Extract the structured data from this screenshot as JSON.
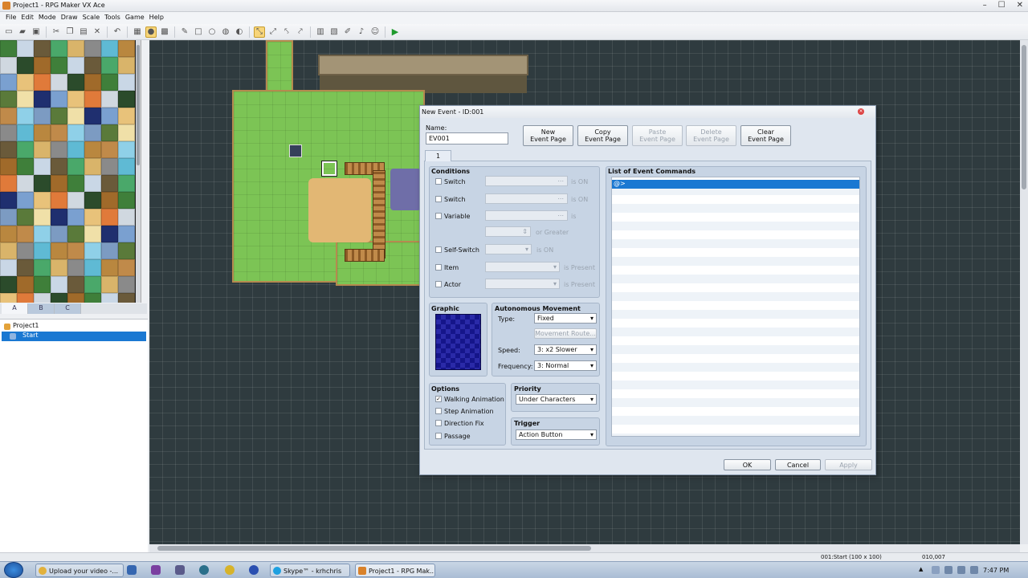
{
  "window": {
    "title": "Project1 - RPG Maker VX Ace",
    "minimize": "–",
    "maximize": "☐",
    "close": "✕"
  },
  "menu": [
    "File",
    "Edit",
    "Mode",
    "Draw",
    "Scale",
    "Tools",
    "Game",
    "Help"
  ],
  "tileset_tabs": [
    "A",
    "B",
    "C"
  ],
  "map_tree": {
    "project": "Project1",
    "map": "Start"
  },
  "dialog": {
    "title": "New Event - ID:001",
    "close": "×",
    "name_label": "Name:",
    "name_value": "EV001",
    "buttons": {
      "new_page": [
        "New",
        "Event Page"
      ],
      "copy_page": [
        "Copy",
        "Event Page"
      ],
      "paste_page": [
        "Paste",
        "Event Page"
      ],
      "delete_page": [
        "Delete",
        "Event Page"
      ],
      "clear_page": [
        "Clear",
        "Event Page"
      ]
    },
    "page_tab": "1",
    "conditions": {
      "title": "Conditions",
      "switch1": "Switch",
      "switch1_suffix": "is ON",
      "switch2": "Switch",
      "switch2_suffix": "is ON",
      "variable": "Variable",
      "variable_suffix": "is",
      "or_greater": "or Greater",
      "self_switch": "Self-Switch",
      "self_switch_suffix": "is ON",
      "item": "Item",
      "item_suffix": "is Present",
      "actor": "Actor",
      "actor_suffix": "is Present",
      "ellipsis": "..."
    },
    "graphic_title": "Graphic",
    "autonomous": {
      "title": "Autonomous Movement",
      "type_label": "Type:",
      "type_value": "Fixed",
      "route_button": "Movement Route...",
      "speed_label": "Speed:",
      "speed_value": "3: x2 Slower",
      "freq_label": "Frequency:",
      "freq_value": "3: Normal"
    },
    "options": {
      "title": "Options",
      "walking": "Walking Animation",
      "walking_checked": "✓",
      "step": "Step Animation",
      "direction": "Direction Fix",
      "passage": "Passage"
    },
    "priority": {
      "title": "Priority",
      "value": "Under Characters"
    },
    "trigger": {
      "title": "Trigger",
      "value": "Action Button"
    },
    "event_commands": {
      "title": "List of Event Commands",
      "first_row": "@>"
    },
    "ok": "OK",
    "cancel": "Cancel",
    "apply": "Apply"
  },
  "status": {
    "map_info": "001:Start (100 x 100)",
    "coords": "010,007"
  },
  "taskbar": {
    "task1": "Upload your video -...",
    "task2": "Skype™ - krhchris",
    "task3": "Project1 - RPG Mak...",
    "clock": "7:47 PM"
  },
  "colors": {
    "accent": "#1a78d2",
    "grass": "#7cc455",
    "map_bg": "#2f3b3f"
  }
}
